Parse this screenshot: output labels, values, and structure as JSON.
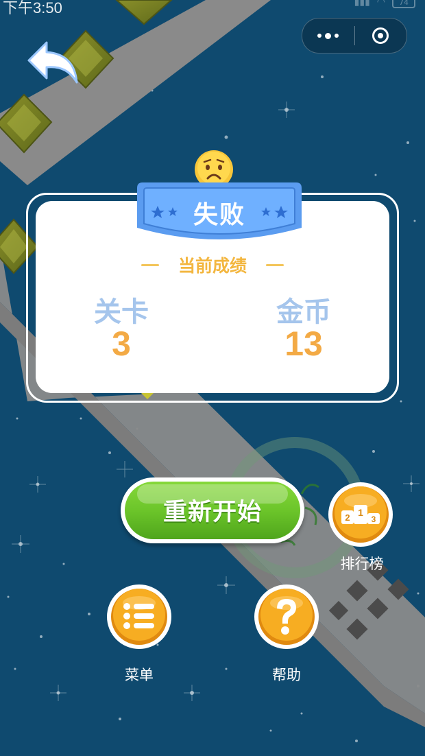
{
  "status_bar": {
    "time": "下午3:50",
    "battery": "74"
  },
  "capsule": {
    "more_icon": "more-dots-icon",
    "close_icon": "target-close-icon"
  },
  "back_icon": "back-arrow-icon",
  "result": {
    "emoji_icon": "sad-face-icon",
    "title": "失败",
    "score_header": "当前成绩",
    "level_label": "关卡",
    "level_value": "3",
    "coins_label": "金币",
    "coins_value": "13"
  },
  "buttons": {
    "restart_label": "重新开始",
    "leaderboard_label": "排行榜",
    "leaderboard_icon": "podium-icon",
    "menu_label": "菜单",
    "menu_icon": "list-icon",
    "help_label": "帮助",
    "help_icon": "question-icon"
  },
  "colors": {
    "background": "#0f4a6f",
    "track": "#8a8a8a",
    "banner": "#5b9cf0",
    "button_orange": "#f6a51f",
    "button_green": "#6cc52a",
    "score_value": "#f3aa45",
    "score_label": "#a5c5ec"
  }
}
